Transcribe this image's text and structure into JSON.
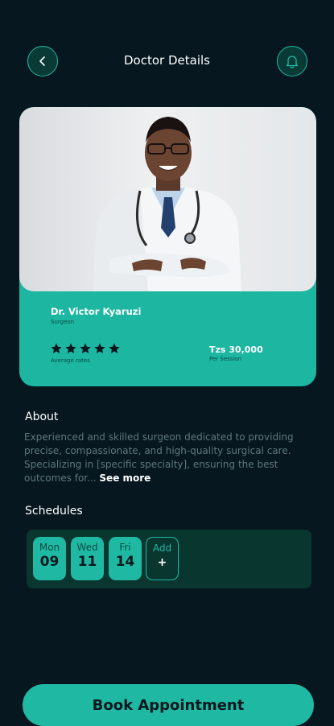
{
  "header": {
    "title": "Doctor Details",
    "back_icon": "chevron-left-icon",
    "bell_icon": "bell-icon"
  },
  "doctor": {
    "name": "Dr. Victor Kyaruzi",
    "role": "Surgeon",
    "rating_stars": 5,
    "rating_label": "Average rates",
    "price": "Tzs 30,000",
    "price_unit": "Per Session"
  },
  "about": {
    "title": "About",
    "text": "Experienced and skilled surgeon dedicated to providing precise, compassionate, and high-quality surgical care. Specializing in [specific specialty], ensuring the best outcomes for...",
    "see_more": "See more"
  },
  "schedules": {
    "title": "Schedules",
    "days": [
      {
        "weekday": "Mon",
        "date": "09"
      },
      {
        "weekday": "Wed",
        "date": "11"
      },
      {
        "weekday": "Fri",
        "date": "14"
      }
    ],
    "add_label": "Add",
    "add_symbol": "+"
  },
  "cta": {
    "label": "Book Appointment"
  },
  "colors": {
    "background": "#06171f",
    "accent": "#1fb9a3"
  }
}
